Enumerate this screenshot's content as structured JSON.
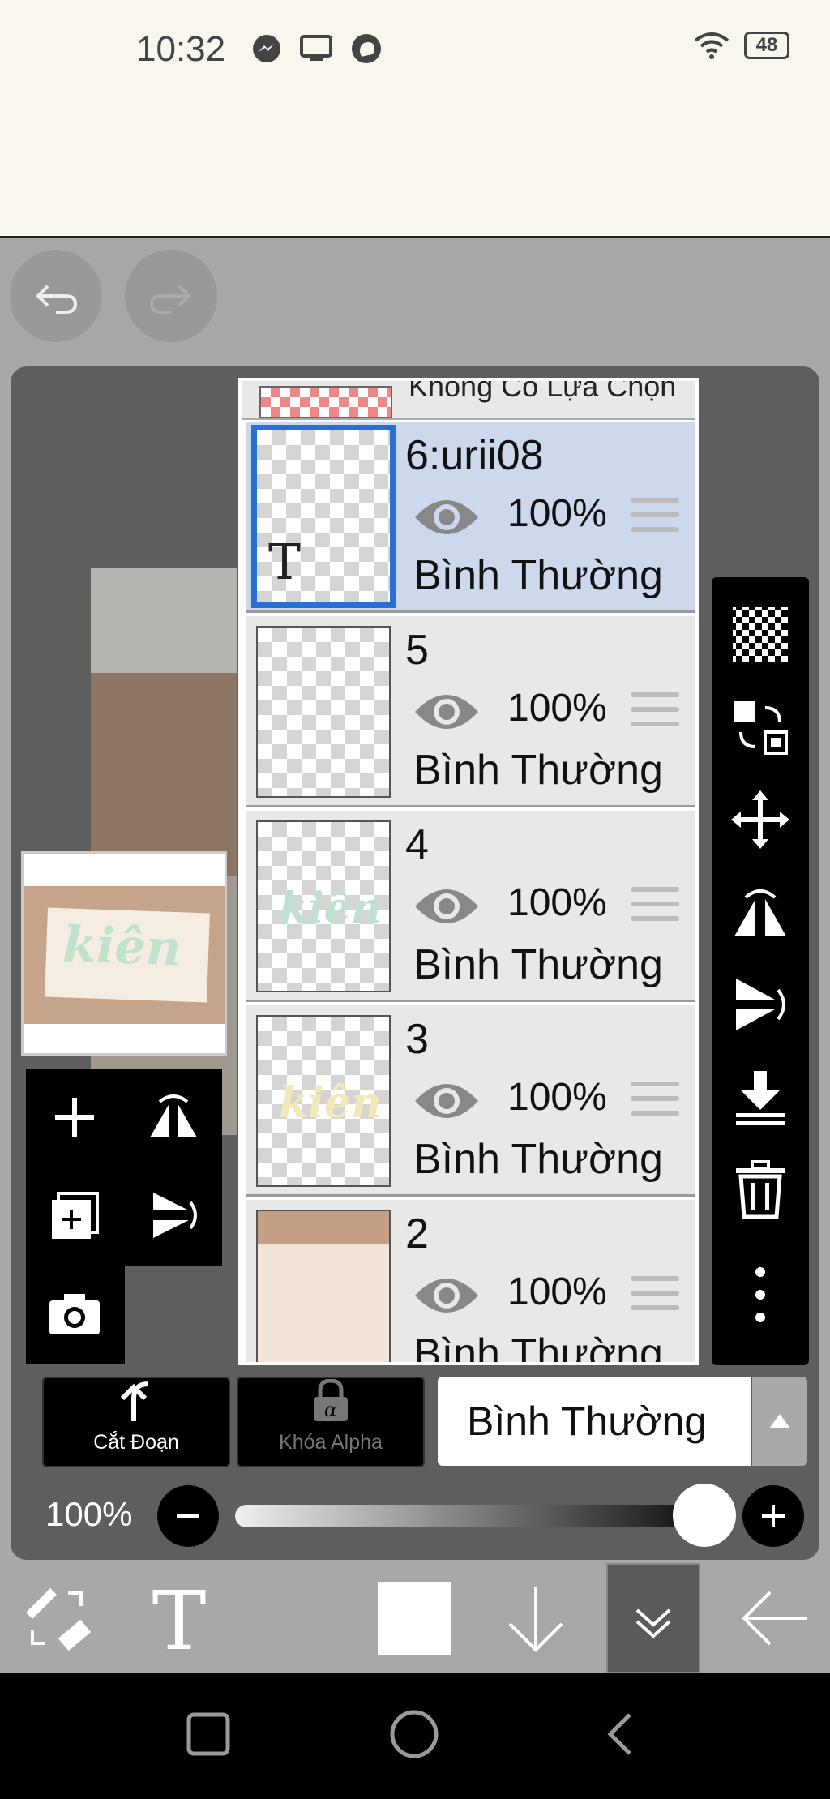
{
  "status_bar": {
    "time": "10:32",
    "battery": "48",
    "icons": [
      "messenger-icon",
      "screen-cast-icon",
      "chat-bubble-icon",
      "wifi-icon",
      "battery-icon"
    ]
  },
  "history": {
    "undo_icon": "undo-icon",
    "redo_icon": "redo-icon"
  },
  "layers": {
    "top_partial": {
      "label": "Không Có Lựa Chọn"
    },
    "items": [
      {
        "name": "6:urii08",
        "opacity": "100%",
        "blend": "Bình Thường",
        "selected": true,
        "thumb_glyph": "T"
      },
      {
        "name": "5",
        "opacity": "100%",
        "blend": "Bình Thường",
        "selected": false
      },
      {
        "name": "4",
        "opacity": "100%",
        "blend": "Bình Thường",
        "selected": false,
        "thumb_text": "kiên"
      },
      {
        "name": "3",
        "opacity": "100%",
        "blend": "Bình Thường",
        "selected": false,
        "thumb_text": "kiên"
      },
      {
        "name": "2",
        "opacity": "100%",
        "blend": "Bình Thường",
        "selected": false
      }
    ]
  },
  "thumbnail": {
    "word": "kiên"
  },
  "bottom_controls": {
    "cut_label": "Cắt Đoạn",
    "alpha_lock_label": "Khóa Alpha",
    "blend_mode": "Bình Thường",
    "opacity_label": "100%",
    "opacity_value": 1.0
  },
  "colors": {
    "selected_row": "#cdd8ec",
    "selected_border": "#2a6fd6",
    "panel": "#5e5e5e",
    "toolbar": "#a8a8a8"
  }
}
